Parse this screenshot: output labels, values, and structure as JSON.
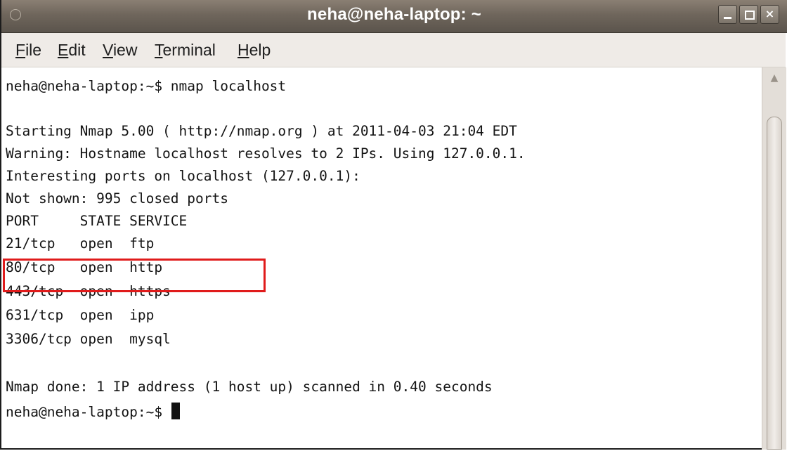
{
  "window": {
    "title": "neha@neha-laptop: ~",
    "controls": {
      "minimize": "minimize",
      "maximize": "maximize",
      "close": "×"
    }
  },
  "menu": {
    "file": {
      "acc": "F",
      "rest": "ile"
    },
    "edit": {
      "acc": "E",
      "rest": "dit"
    },
    "view": {
      "acc": "V",
      "rest": "iew"
    },
    "terminal": {
      "acc": "T",
      "rest": "erminal"
    },
    "help": {
      "acc": "H",
      "rest": "elp"
    }
  },
  "terminal": {
    "lines": [
      "neha@neha-laptop:~$ nmap localhost",
      "",
      "Starting Nmap 5.00 ( http://nmap.org ) at 2011-04-03 21:04 EDT",
      "Warning: Hostname localhost resolves to 2 IPs. Using 127.0.0.1.",
      "Interesting ports on localhost (127.0.0.1):",
      "Not shown: 995 closed ports",
      "PORT     STATE SERVICE",
      "21/tcp   open  ftp",
      "80/tcp   open  http",
      "443/tcp  open  https",
      "631/tcp  open  ipp",
      "3306/tcp open  mysql",
      "",
      "Nmap done: 1 IP address (1 host up) scanned in 0.40 seconds",
      "neha@neha-laptop:~$ "
    ]
  },
  "annotation": {
    "highlight_color": "#e01b1b"
  },
  "colors": {
    "titlebar": "#6f665c",
    "menubar": "#efebe7",
    "terminal_bg": "#ffffff",
    "terminal_fg": "#141414"
  }
}
